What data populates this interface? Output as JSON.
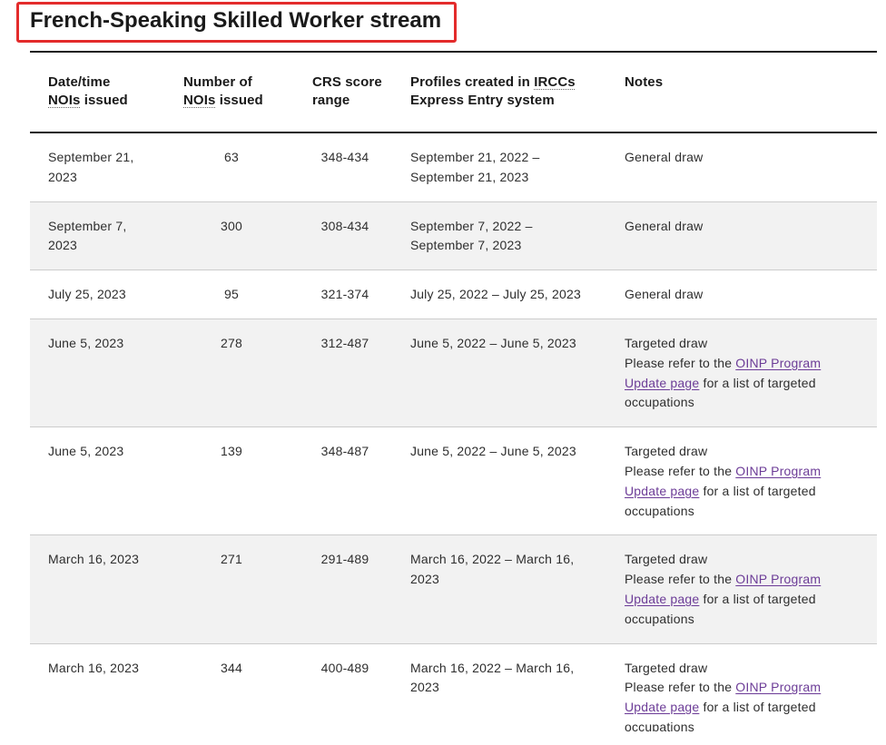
{
  "page": {
    "section_title": "French-Speaking Skilled Worker stream"
  },
  "colors": {
    "text": "#1a1a1a",
    "body_text": "#2e2e2e",
    "row_alt_bg": "#f2f2f2",
    "link": "#6c3c97",
    "highlight": "#e32b2b",
    "rule": "#1a1a1a",
    "row_border": "#cccccc",
    "page_bg": "#ffffff"
  },
  "table": {
    "headers": {
      "date": {
        "before": "Date/time ",
        "abbr": "NOIs",
        "after": " issued"
      },
      "number": {
        "before": "Number of ",
        "abbr": "NOIs",
        "after": " issued"
      },
      "crs": {
        "text": "CRS score range"
      },
      "profiles": {
        "before": "Profiles created in ",
        "abbr": "IRCCs",
        "after": " Express Entry system"
      },
      "notes": {
        "text": "Notes"
      }
    },
    "rows": [
      {
        "date": "September 21, 2023",
        "nois": "63",
        "crs": "348-434",
        "profiles": "September 21, 2022 – September 21, 2023",
        "notes": {
          "type": "General draw"
        }
      },
      {
        "date": "September 7, 2023",
        "nois": "300",
        "crs": "308-434",
        "profiles": "September 7, 2022 – September 7, 2023",
        "notes": {
          "type": "General draw"
        }
      },
      {
        "date": "July 25, 2023",
        "nois": "95",
        "crs": "321-374",
        "profiles": "July 25, 2022 – July 25, 2023",
        "notes": {
          "type": "General draw"
        }
      },
      {
        "date": "June 5, 2023",
        "nois": "278",
        "crs": "312-487",
        "profiles": "June 5, 2022 – June 5, 2023",
        "notes": {
          "type": "Targeted draw",
          "text_before": "Please refer to the ",
          "link": "OINP Program Update page",
          "text_after": " for a list of targeted occupations"
        }
      },
      {
        "date": "June 5, 2023",
        "nois": "139",
        "crs": "348-487",
        "profiles": "June 5, 2022 – June 5, 2023",
        "notes": {
          "type": "Targeted draw",
          "text_before": "Please refer to the ",
          "link": "OINP Program Update page",
          "text_after": " for a list of targeted occupations"
        }
      },
      {
        "date": "March 16, 2023",
        "nois": "271",
        "crs": "291-489",
        "profiles": "March 16, 2022 – March 16, 2023",
        "notes": {
          "type": "Targeted draw",
          "text_before": "Please refer to the ",
          "link": "OINP Program Update page",
          "text_after": " for a list of targeted occupations"
        }
      },
      {
        "date": "March 16, 2023",
        "nois": "344",
        "crs": "400-489",
        "profiles": "March 16, 2022 – March 16, 2023",
        "notes": {
          "type": "Targeted draw",
          "text_before": "Please refer to the ",
          "link": "OINP Program Update page",
          "text_after": " for a list of targeted occupations"
        }
      }
    ]
  }
}
